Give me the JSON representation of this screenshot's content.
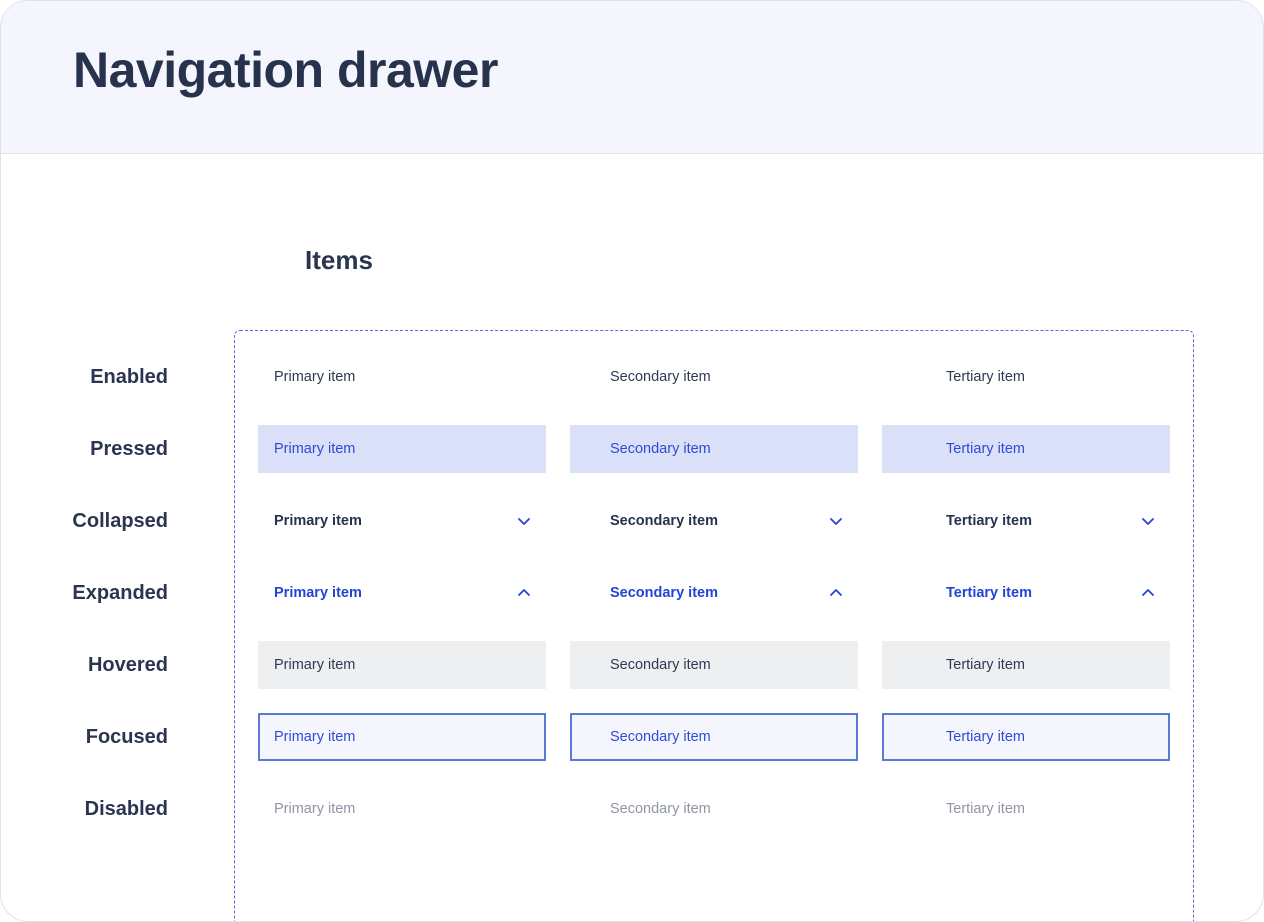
{
  "title": "Navigation drawer",
  "section": "Items",
  "colors": {
    "accent": "#2543d4",
    "pressed_bg": "#dae0f8",
    "hovered_bg": "#eeeff1",
    "focus_border": "#5b79d8",
    "header_bg": "#f5f6fd",
    "frame_dash": "#6a63d6"
  },
  "rows": [
    {
      "label": "Enabled",
      "items": [
        "Primary item",
        "Secondary item",
        "Tertiary item"
      ]
    },
    {
      "label": "Pressed",
      "items": [
        "Primary item",
        "Secondary item",
        "Tertiary item"
      ]
    },
    {
      "label": "Collapsed",
      "items": [
        "Primary item",
        "Secondary item",
        "Tertiary item"
      ],
      "icon": "chevron-down-icon"
    },
    {
      "label": "Expanded",
      "items": [
        "Primary item",
        "Secondary item",
        "Tertiary item"
      ],
      "icon": "chevron-up-icon"
    },
    {
      "label": "Hovered",
      "items": [
        "Primary item",
        "Secondary item",
        "Tertiary item"
      ]
    },
    {
      "label": "Focused",
      "items": [
        "Primary item",
        "Secondary item",
        "Tertiary item"
      ]
    },
    {
      "label": "Disabled",
      "items": [
        "Primary item",
        "Secondary item",
        "Tertiary item"
      ]
    }
  ]
}
